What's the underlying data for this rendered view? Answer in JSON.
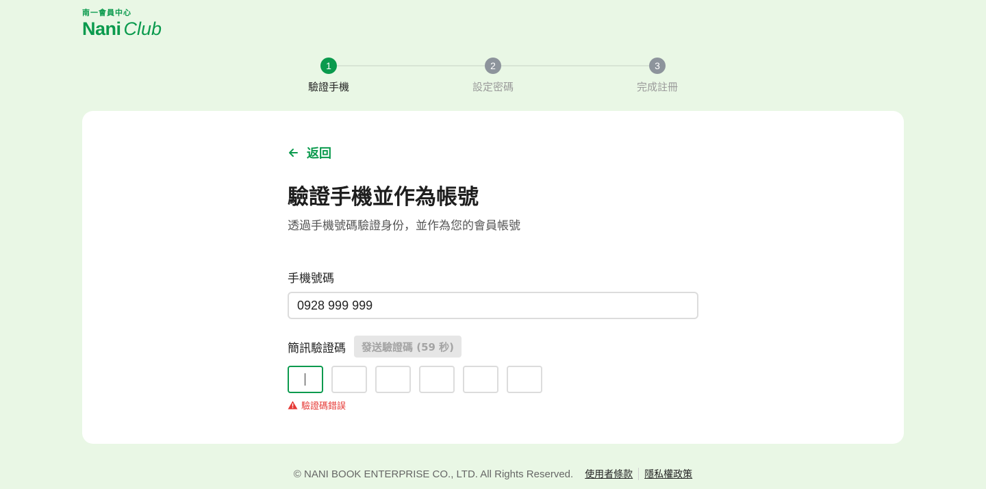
{
  "logo": {
    "subtitle": "南一會員中心",
    "name_bold": "Nani",
    "name_script": "Club"
  },
  "stepper": {
    "steps": [
      {
        "number": "1",
        "label": "驗證手機",
        "state": "active"
      },
      {
        "number": "2",
        "label": "設定密碼",
        "state": "inactive"
      },
      {
        "number": "3",
        "label": "完成註冊",
        "state": "inactive"
      }
    ]
  },
  "form": {
    "back_label": "返回",
    "title": "驗證手機並作為帳號",
    "subtitle": "透過手機號碼驗證身份，並作為您的會員帳號",
    "phone_label": "手機號碼",
    "phone_value": "0928 999 999",
    "sms_label": "簡訊驗證碼",
    "send_code_label": "發送驗證碼 (59 秒)",
    "otp_digits": [
      "",
      "",
      "",
      "",
      "",
      ""
    ],
    "error_text": "驗證碼錯誤"
  },
  "footer": {
    "copyright": "© NANI BOOK ENTERPRISE CO., LTD. All Rights Reserved.",
    "terms_link": "使用者條款",
    "privacy_link": "隱私權政策"
  },
  "colors": {
    "page_bg": "#e9f7e5",
    "brand_green": "#0a9a4d",
    "step_inactive": "#8d949c",
    "step_label_active": "#222222",
    "step_label_inactive": "#9a9a9a",
    "error_red": "#e53935"
  }
}
